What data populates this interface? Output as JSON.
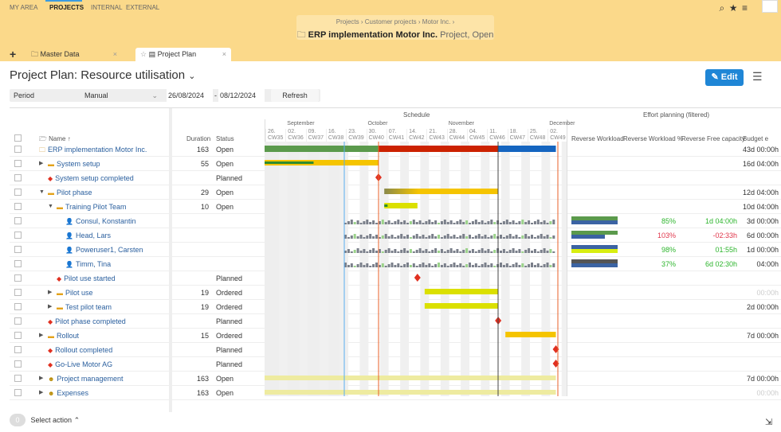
{
  "nav": {
    "items": [
      "MY AREA",
      "PROJECTS",
      "INTERNAL",
      "EXTERNAL"
    ]
  },
  "breadcrumb": {
    "items": [
      "Projects",
      "Customer projects",
      "Motor Inc."
    ],
    "title": "ERP implementation Motor Inc.",
    "subtitle": "Project, Open"
  },
  "tabs": [
    {
      "label": "Master Data"
    },
    {
      "label": "Project Plan",
      "active": true
    }
  ],
  "page": {
    "title": "Project Plan: Resource utilisation",
    "edit": "Edit"
  },
  "filter": {
    "label": "Period",
    "mode": "Manual",
    "from": "26/08/2024",
    "to": "08/12/2024",
    "refresh": "Refresh"
  },
  "columns": {
    "name": "Name",
    "duration": "Duration",
    "status": "Status",
    "schedule": "Schedule",
    "effort": "Effort planning (filtered)",
    "rw": "Reverse Workload",
    "rwp": "Reverse Workload %",
    "rfc": "Reverse Free capacity",
    "budget": "Budget e"
  },
  "months": [
    {
      "label": "September",
      "week": 1
    },
    {
      "label": "October",
      "week": 5
    },
    {
      "label": "November",
      "week": 9
    },
    {
      "label": "December",
      "week": 14
    }
  ],
  "weeks": [
    [
      "26.",
      "CW35"
    ],
    [
      "02.",
      "CW36"
    ],
    [
      "09.",
      "CW37"
    ],
    [
      "16.",
      "CW38"
    ],
    [
      "23.",
      "CW39"
    ],
    [
      "30.",
      "CW40"
    ],
    [
      "07.",
      "CW41"
    ],
    [
      "14.",
      "CW42"
    ],
    [
      "21.",
      "CW43"
    ],
    [
      "28.",
      "CW44"
    ],
    [
      "04.",
      "CW45"
    ],
    [
      "11.",
      "CW46"
    ],
    [
      "18.",
      "CW47"
    ],
    [
      "25.",
      "CW48"
    ],
    [
      "02.",
      "CW49"
    ]
  ],
  "rows": [
    {
      "name": "ERP implementation Motor Inc.",
      "level": 0,
      "type": "project",
      "duration": "163",
      "status": "Open",
      "budget": "43d 00:00h",
      "bar": {
        "start": 0,
        "end": 101,
        "kind": "project"
      }
    },
    {
      "name": "System setup",
      "level": 1,
      "type": "phase",
      "expand": true,
      "duration": "55",
      "status": "Open",
      "budget": "16d 04:00h",
      "bar": {
        "start": 0,
        "end": 39.5,
        "progress": 0.43,
        "kind": "task"
      }
    },
    {
      "name": "System setup completed",
      "level": 1,
      "type": "milestone",
      "status": "Planned",
      "ms": 39.5
    },
    {
      "name": "Pilot phase",
      "level": 1,
      "type": "phase",
      "expand": true,
      "open": true,
      "duration": "29",
      "status": "Open",
      "budget": "12d 04:00h",
      "bar": {
        "start": 41.5,
        "end": 81,
        "kind": "grad"
      }
    },
    {
      "name": "Training Pilot Team",
      "level": 2,
      "type": "phase",
      "expand": true,
      "open": true,
      "duration": "10",
      "status": "Open",
      "budget": "10d 04:00h",
      "bar": {
        "start": 41.5,
        "end": 53,
        "kind": "lime",
        "progress": 0.1
      }
    },
    {
      "name": "Consul, Konstantin",
      "level": 3,
      "type": "person",
      "rwp": "85%",
      "rfc": "1d 04:00h",
      "budget": "3d 00:00h",
      "ok": true,
      "wl": [
        "#5b9a4c",
        "#3b63a3"
      ]
    },
    {
      "name": "Head, Lars",
      "level": 3,
      "type": "person",
      "rwp": "103%",
      "rfc": "-02:33h",
      "budget": "6d 00:00h",
      "ok": false,
      "wl": [
        "#5b9a4c",
        "#3b63a3"
      ]
    },
    {
      "name": "Poweruser1, Carsten",
      "level": 3,
      "type": "person",
      "rwp": "98%",
      "rfc": "01:55h",
      "budget": "1d 00:00h",
      "ok": true,
      "wl": [
        "#3b63a3",
        "#d8ee10"
      ]
    },
    {
      "name": "Timm, Tina",
      "level": 3,
      "type": "person",
      "rwp": "37%",
      "rfc": "6d 02:30h",
      "budget": "04:00h",
      "ok": true,
      "wl": [
        "#555",
        "#3b63a3"
      ]
    },
    {
      "name": "Pilot use started",
      "level": 2,
      "type": "milestone",
      "status": "Planned",
      "ms": 53
    },
    {
      "name": "Pilot use",
      "level": 2,
      "type": "phase",
      "expand": true,
      "duration": "19",
      "status": "Ordered",
      "budget": "00:00h",
      "faint": true,
      "bar": {
        "start": 55.5,
        "end": 81,
        "kind": "lime"
      }
    },
    {
      "name": "Test pilot team",
      "level": 2,
      "type": "phase",
      "expand": true,
      "duration": "19",
      "status": "Ordered",
      "budget": "2d 00:00h",
      "bar": {
        "start": 55.5,
        "end": 81,
        "kind": "lime"
      }
    },
    {
      "name": "Pilot phase completed",
      "level": 1,
      "type": "milestone",
      "status": "Planned",
      "ms": 81
    },
    {
      "name": "Rollout",
      "level": 1,
      "type": "phase",
      "expand": true,
      "duration": "15",
      "status": "Ordered",
      "budget": "7d 00:00h",
      "bar": {
        "start": 83.5,
        "end": 101,
        "kind": "task"
      }
    },
    {
      "name": "Rollout completed",
      "level": 1,
      "type": "milestone",
      "status": "Planned",
      "ms": 101
    },
    {
      "name": "Go-Live Motor AG",
      "level": 1,
      "type": "milestone",
      "status": "Planned",
      "ms": 101
    },
    {
      "name": "Project management",
      "level": 1,
      "type": "special",
      "expand": true,
      "duration": "163",
      "status": "Open",
      "budget": "7d 00:00h",
      "bar": {
        "start": 0,
        "end": 101,
        "kind": "pale"
      }
    },
    {
      "name": "Expenses",
      "level": 1,
      "type": "special",
      "expand": true,
      "duration": "163",
      "status": "Open",
      "budget": "00:00h",
      "faint": true,
      "bar": {
        "start": 0,
        "end": 101,
        "kind": "pale"
      }
    }
  ],
  "footer": {
    "count": "0",
    "action": "Select action"
  },
  "colors": {
    "accent": "#1f86d6",
    "ok": "#2db52d",
    "bad": "#e0364b",
    "bar": "#f5c400",
    "green": "#5b9a4c",
    "red": "#cc2200",
    "blue": "#1565c0"
  }
}
